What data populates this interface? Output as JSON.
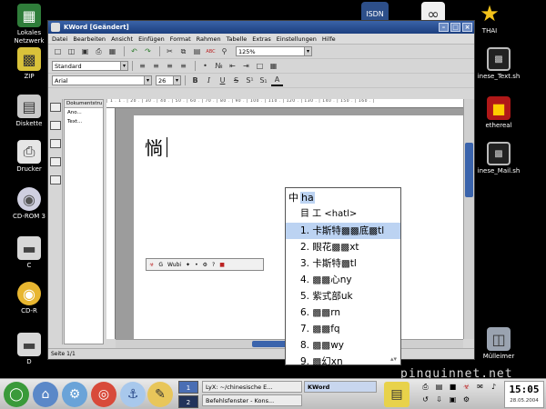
{
  "desktop": {
    "left_icons": [
      {
        "label": "Lokales Netzwerk",
        "icon": "network-icon"
      },
      {
        "label": "ZIP",
        "icon": "zip-disk-icon"
      },
      {
        "label": "Diskette",
        "icon": "floppy-icon"
      },
      {
        "label": "Drucker",
        "icon": "printer-icon"
      },
      {
        "label": "CD-ROM 3",
        "icon": "cdrom-icon"
      },
      {
        "label": "C",
        "icon": "harddisk-icon"
      },
      {
        "label": "CD-R",
        "icon": "cdr-icon"
      },
      {
        "label": "D",
        "icon": "harddisk-icon"
      }
    ],
    "top_icons": [
      {
        "label": "ISDN",
        "icon": "isdn-icon"
      },
      {
        "label": "",
        "icon": "connect-icon"
      },
      {
        "label": "THAI",
        "icon": "star-icon"
      }
    ],
    "right_icons": [
      {
        "label": "inese_Text.sh",
        "icon": "terminal-icon"
      },
      {
        "label": "ethereal",
        "icon": "lock-icon"
      },
      {
        "label": "inese_Mail.sh",
        "icon": "terminal-icon"
      },
      {
        "label": "Mülleimer",
        "icon": "trash-icon"
      }
    ],
    "watermark": "pinguinnet.net"
  },
  "window": {
    "title": "KWord [Geändert]",
    "menu": [
      "Datei",
      "Bearbeiten",
      "Ansicht",
      "Einfügen",
      "Format",
      "Rahmen",
      "Tabelle",
      "Extras",
      "Einstellungen",
      "Hilfe"
    ],
    "zoom": "125%",
    "style": "Standard",
    "font": "Arial",
    "font_size": "26",
    "docstruct_header": "Dokumentstru",
    "docstruct_items": [
      "Ano...",
      "Text..."
    ],
    "typed_char": "惝",
    "statusbar": "Seite 1/1"
  },
  "ime_toolbar": {
    "label": "Wubi"
  },
  "candidates": {
    "mode_char": "中",
    "input": "ha",
    "hint": "目 工 <hatl>",
    "items": [
      "1. 卡斯特▩▩底▩tl",
      "2. 眼花▩▩xt",
      "3. 卡斯特▩tl",
      "4. ▩▩心ny",
      "5. 紫式部uk",
      "6. ▩▩rn",
      "7. ▩▩fq",
      "8. ▩▩wy",
      "9. ▩幻xn"
    ],
    "selected_index": 0
  },
  "taskbar": {
    "pager": [
      "1",
      "2"
    ],
    "tasks": [
      "LyX: ~/chinesische E...",
      "KWord",
      "Befehlsfenster - Kons..."
    ],
    "clock_time": "15:05",
    "clock_date": "28.05.2004"
  }
}
